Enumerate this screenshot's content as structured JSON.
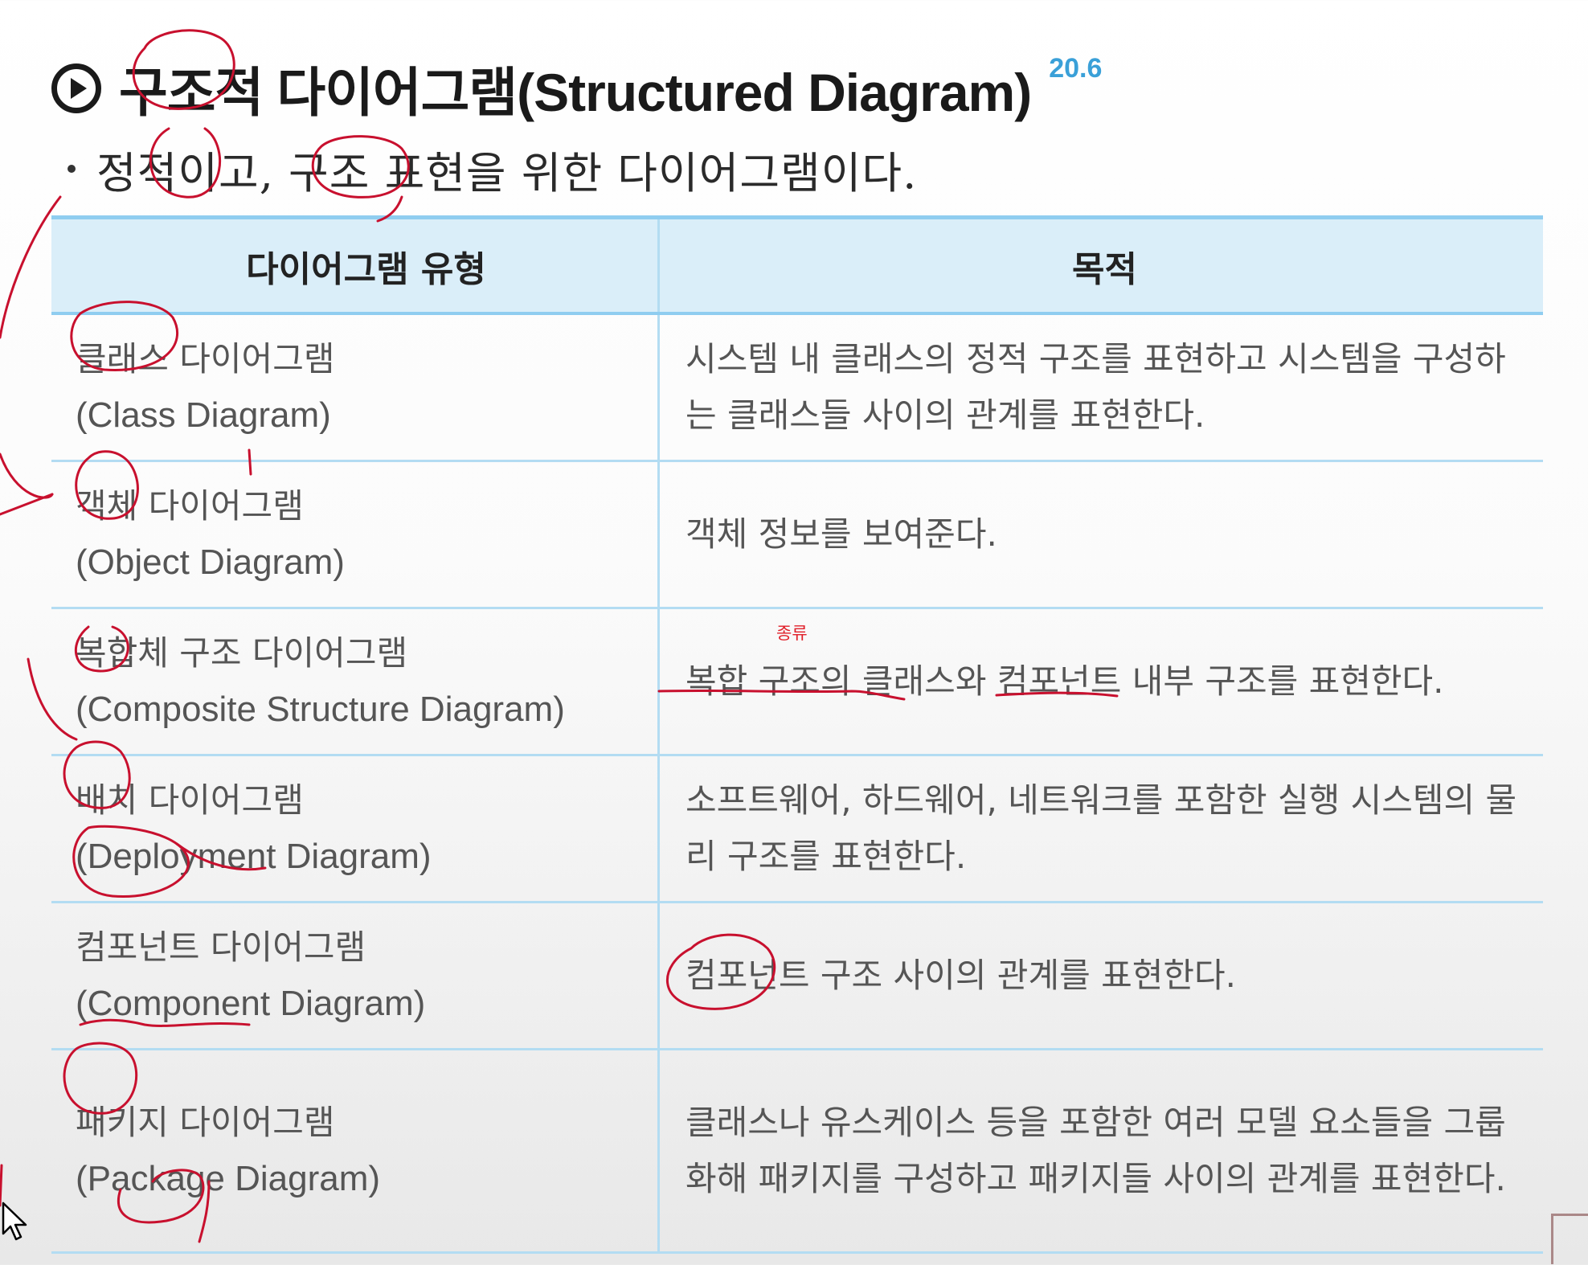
{
  "header": {
    "title": "구조적 다이어그램(Structured Diagram)",
    "ref": "20.6",
    "bullet": "정적이고, 구조 표현을 위한 다이어그램이다."
  },
  "table": {
    "headers": [
      "다이어그램 유형",
      "목적"
    ],
    "rows": [
      {
        "name": "클래스 다이어그램",
        "english": "(Class Diagram)",
        "purpose": "시스템 내 클래스의 정적 구조를 표현하고 시스템을 구성하는 클래스들 사이의 관계를 표현한다."
      },
      {
        "name": "객체 다이어그램",
        "english": "(Object Diagram)",
        "purpose": "객체 정보를 보여준다."
      },
      {
        "name": "복합체 구조 다이어그램",
        "english": "(Composite Structure Diagram)",
        "purpose": "복합 구조의 클래스와 컴포넌트 내부 구조를 표현한다."
      },
      {
        "name": "배치 다이어그램",
        "english": "(Deployment Diagram)",
        "purpose": "소프트웨어, 하드웨어, 네트워크를 포함한 실행 시스템의 물리 구조를 표현한다."
      },
      {
        "name": "컴포넌트 다이어그램",
        "english": "(Component Diagram)",
        "purpose": "컴포넌트 구조 사이의 관계를 표현한다."
      },
      {
        "name": "패키지 다이어그램",
        "english": "(Package Diagram)",
        "purpose": "클래스나 유스케이스 등을 포함한 여러 모델 요소들을 그룹화해 패키지를 구성하고 패키지들 사이의 관계를 표현한다."
      }
    ]
  },
  "annotation": {
    "note": "종류",
    "ink_color": "#c8102e"
  },
  "icons": {
    "title_icon": "play-circle-icon",
    "cursor": "mouse-cursor-icon"
  }
}
